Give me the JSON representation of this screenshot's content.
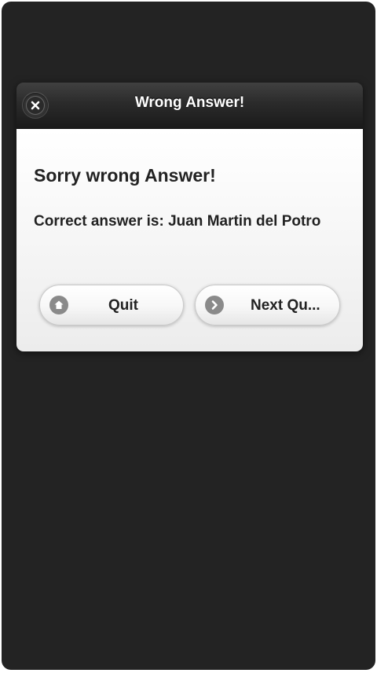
{
  "dialog": {
    "title": "Wrong Answer!",
    "heading": "Sorry wrong Answer!",
    "answer_text": "Correct answer is: Juan Martin del Potro",
    "buttons": {
      "quit_label": "Quit",
      "next_label": "Next Qu..."
    },
    "icons": {
      "close": "close-icon",
      "quit": "home-icon",
      "next": "arrow-right-icon"
    }
  },
  "colors": {
    "background": "#232323",
    "header": "#1a1a1a",
    "body": "#f4f4f4",
    "text": "#222222"
  }
}
